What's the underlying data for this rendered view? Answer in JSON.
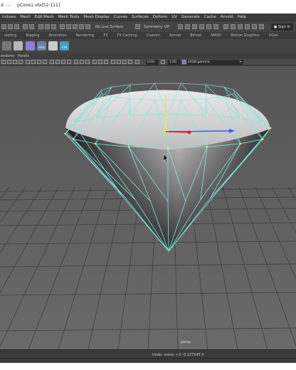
{
  "window": {
    "prefix": "d",
    "dashes": "- -",
    "title": "pCone1.vtx[52:111]"
  },
  "menubar": [
    "indows",
    "Mesh",
    "Edit Mesh",
    "Mesh Tools",
    "Mesh Display",
    "Curves",
    "Surfaces",
    "Deform",
    "UV",
    "Generate",
    "Cache",
    "Arnold",
    "Help"
  ],
  "status": {
    "live_surface": "No Live Surface",
    "symmetry": "Symmetry: Off",
    "sign_in": "Sign In"
  },
  "shelf_tabs": [
    "ulpting",
    "Rigging",
    "Animation",
    "Rendering",
    "FX",
    "FX Caching",
    "Custom",
    "Arnold",
    "Bifrost",
    "MASH",
    "Motion Graphics",
    "XGen"
  ],
  "shelf_labels": {
    "hist": "Hist",
    "cw": "CW"
  },
  "panel_menu": [
    "enderer",
    "Panels"
  ],
  "view_toolbar": {
    "value_a": "0.00",
    "value_b": "1.00",
    "color_space": "sRGB gamma"
  },
  "viewport": {
    "camera_label": "persp",
    "background_color": "#5b5b5b",
    "wire_color": "#7fe8e0",
    "selected_vertex_color": "#e5f05a"
  },
  "help_line": {
    "undo": "Undo: move -r 0 -0.127545 0"
  }
}
